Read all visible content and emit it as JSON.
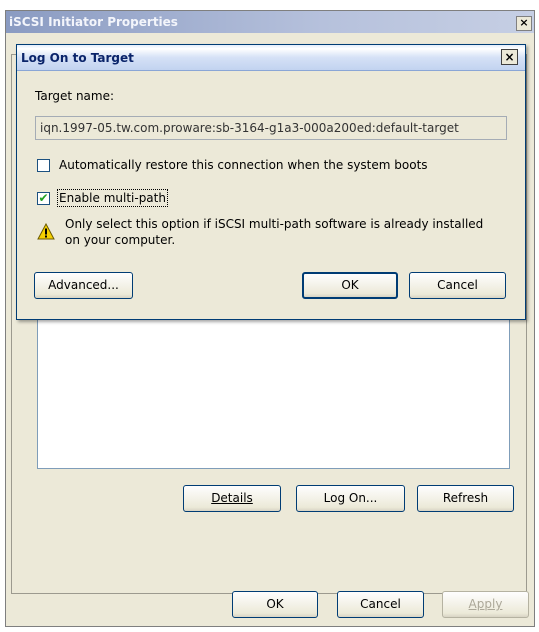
{
  "outer_window": {
    "title": "iSCSI Initiator Properties",
    "close_glyph": "×",
    "buttons": {
      "details": "Details",
      "log_on": "Log On...",
      "refresh": "Refresh",
      "ok": "OK",
      "cancel": "Cancel",
      "apply": "Apply"
    }
  },
  "dialog": {
    "title": "Log On to Target",
    "close_glyph": "×",
    "target_name_label": "Target name:",
    "target_name_value": "iqn.1997-05.tw.com.proware:sb-3164-g1a3-000a200ed:default-target",
    "checkbox_restore": {
      "label": "Automatically restore this connection when the system boots",
      "checked": false
    },
    "checkbox_multipath": {
      "label": "Enable multi-path",
      "checked": true,
      "mark": "✔"
    },
    "warning_line1": "Only select this option if iSCSI multi-path software is already installed",
    "warning_line2": "on your computer.",
    "buttons": {
      "advanced": "Advanced...",
      "ok": "OK",
      "cancel": "Cancel"
    }
  },
  "colors": {
    "warning_icon": "#f5d000"
  }
}
